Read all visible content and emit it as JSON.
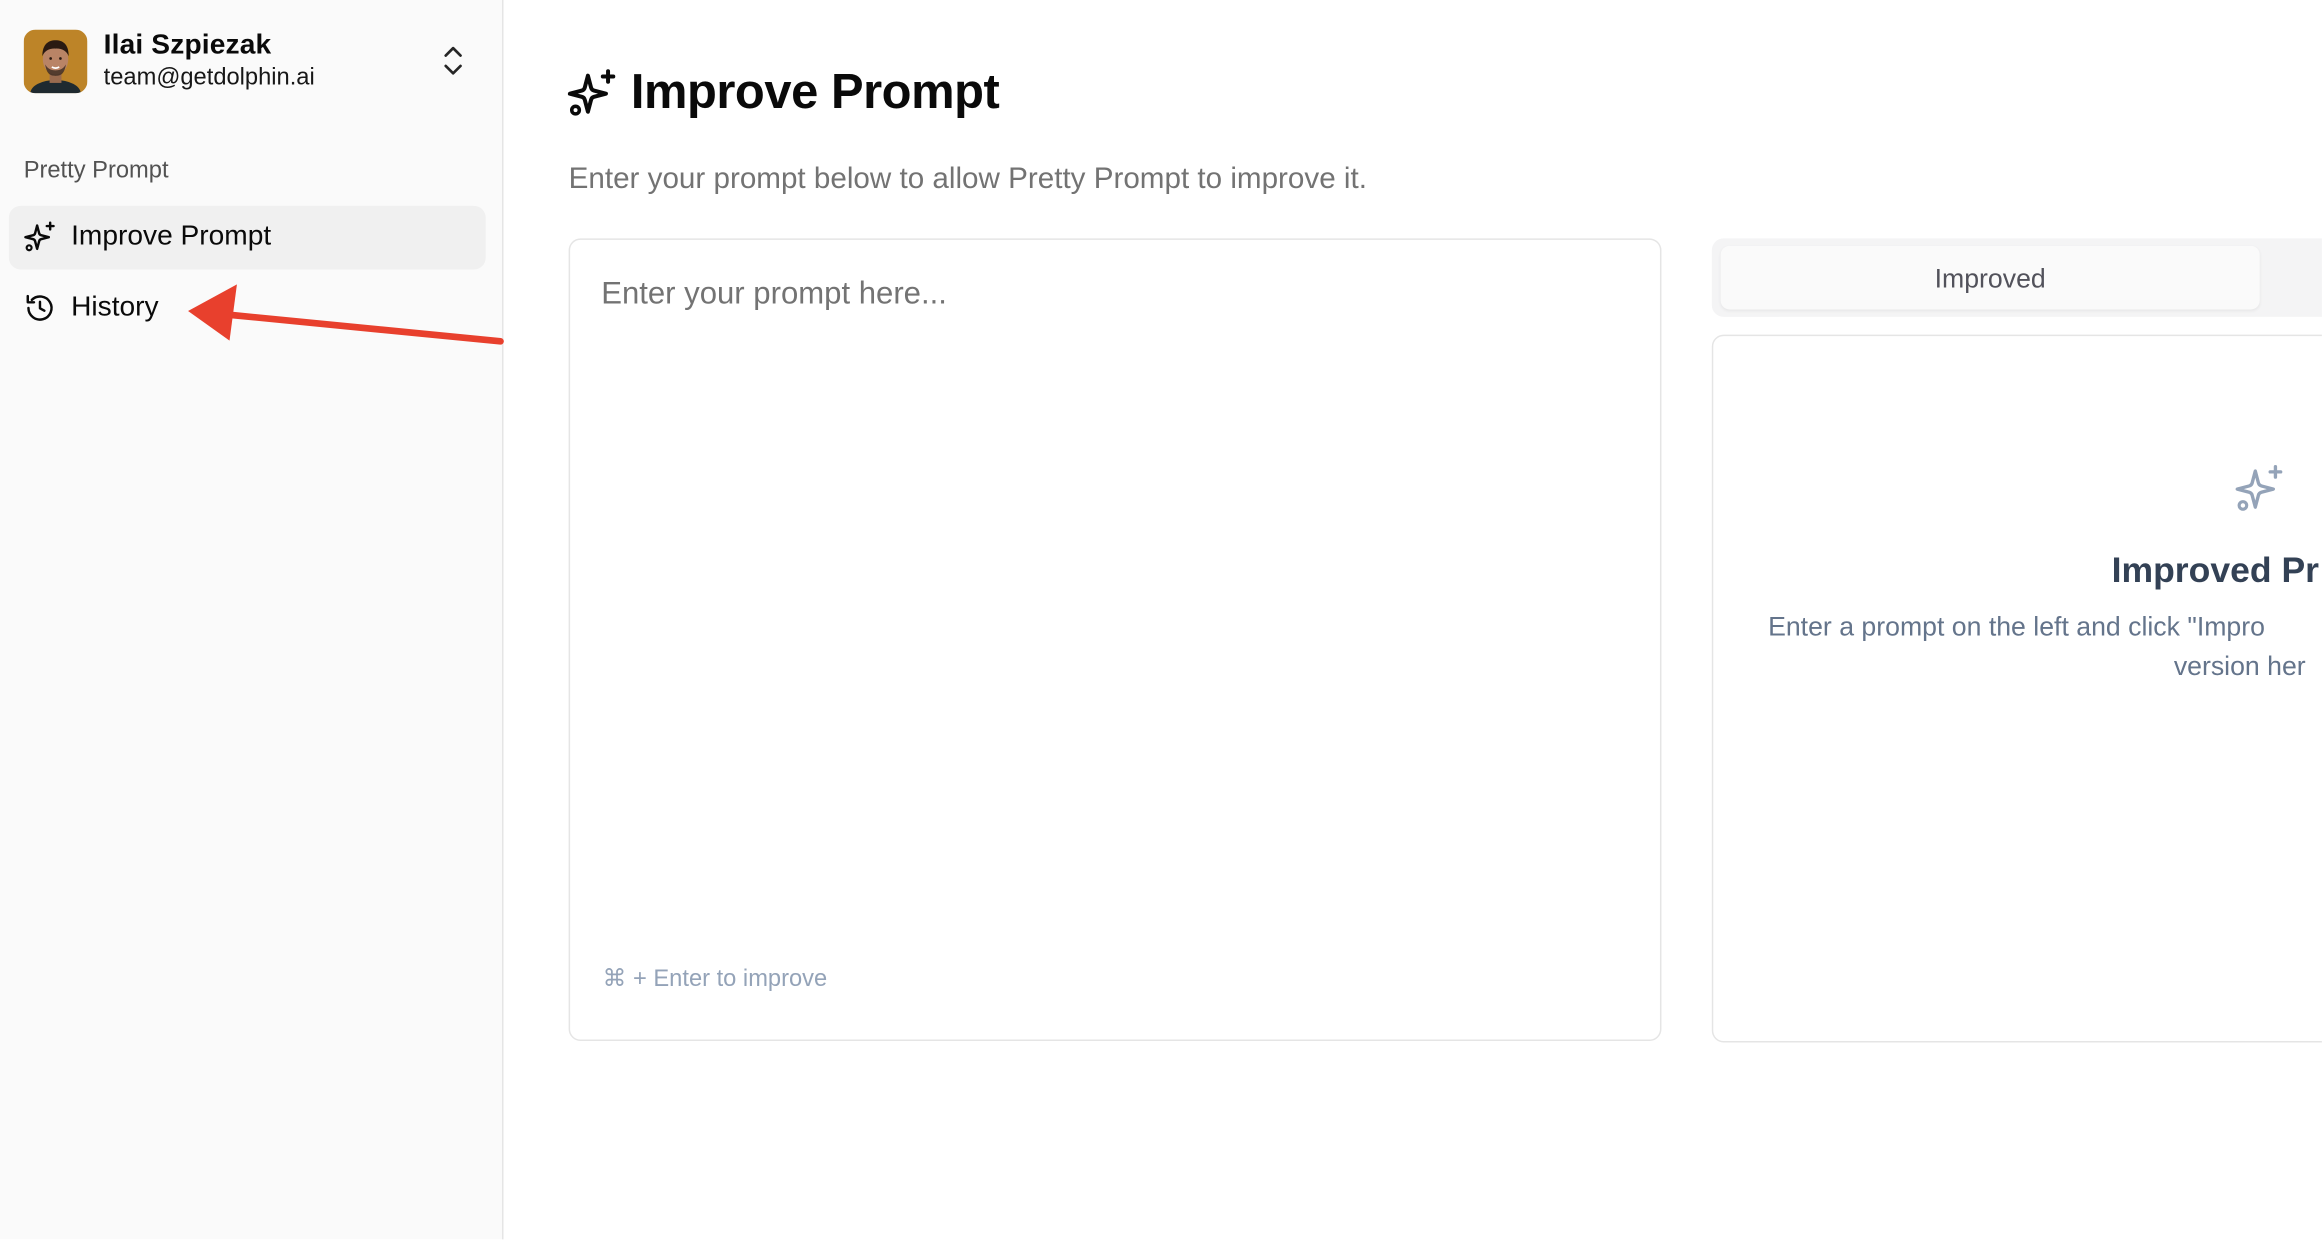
{
  "user": {
    "name": "Ilai Szpiezak",
    "email": "team@getdolphin.ai",
    "avatar_icon": "user-avatar-photo",
    "switcher_icon": "chevrons-up-down-icon"
  },
  "sidebar": {
    "group_label": "Pretty Prompt",
    "items": [
      {
        "label": "Improve Prompt",
        "icon": "sparkles-icon",
        "active": true
      },
      {
        "label": "History",
        "icon": "history-icon",
        "active": false
      }
    ]
  },
  "main": {
    "title": "Improve Prompt",
    "title_icon": "sparkles-icon",
    "subtitle": "Enter your prompt below to allow Pretty Prompt to improve it.",
    "prompt": {
      "placeholder": "Enter your prompt here...",
      "value": "",
      "hint": "⌘ + Enter to improve"
    },
    "result": {
      "tabs": [
        {
          "label": "Improved",
          "active": true
        }
      ],
      "icon": "sparkles-icon",
      "title": "Improved Pr",
      "desc_line1": "Enter a prompt on the left and click \"Impro",
      "desc_line2": "version her"
    }
  },
  "annotation": {
    "arrow_color": "#e8402d",
    "points_to": "History"
  },
  "colors": {
    "sidebar_bg": "#fafafa",
    "active_item_bg": "#f0f0f0",
    "border": "#e5e5e5",
    "muted_text": "#737373",
    "result_title": "#334155",
    "result_text": "#64748b"
  }
}
